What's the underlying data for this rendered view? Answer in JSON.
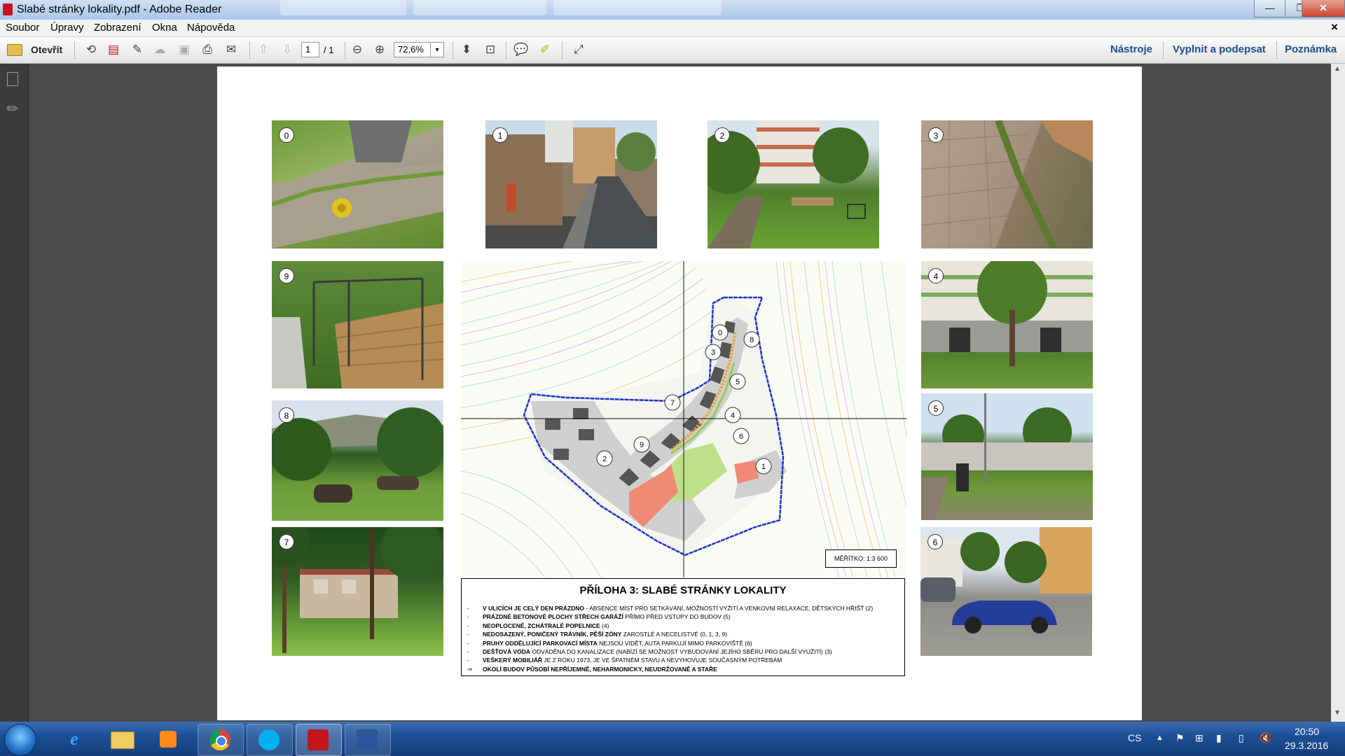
{
  "window": {
    "title": "Slabé stránky lokality.pdf - Adobe Reader",
    "minimize": "—",
    "maximize": "❐",
    "close": "✕"
  },
  "menubar": {
    "items": [
      "Soubor",
      "Úpravy",
      "Zobrazení",
      "Okna",
      "Nápověda"
    ],
    "close_doc": "×"
  },
  "toolbar": {
    "open_label": "Otevřít",
    "page_current": "1",
    "page_total": "/ 1",
    "zoom": "72,6%",
    "tools": "Nástroje",
    "fill_sign": "Vyplnit a podepsat",
    "comment": "Poznámka"
  },
  "document": {
    "photos": [
      {
        "id": "photo-0",
        "number": "0"
      },
      {
        "id": "photo-1",
        "number": "1"
      },
      {
        "id": "photo-2",
        "number": "2"
      },
      {
        "id": "photo-3",
        "number": "3"
      },
      {
        "id": "photo-9",
        "number": "9"
      },
      {
        "id": "photo-4",
        "number": "4"
      },
      {
        "id": "photo-8",
        "number": "8"
      },
      {
        "id": "photo-5",
        "number": "5"
      },
      {
        "id": "photo-7",
        "number": "7"
      },
      {
        "id": "photo-6",
        "number": "6"
      }
    ],
    "map": {
      "scale": "MĚŘÍTKO: 1:3 600",
      "markers": [
        "0",
        "8",
        "3",
        "5",
        "7",
        "4",
        "6",
        "9",
        "2",
        "1"
      ]
    },
    "legend": {
      "heading": "PŘÍLOHA 3: SLABÉ STRÁNKY LOKALITY",
      "items": [
        {
          "bullet": "-",
          "bold": "V ULICÍCH JE CELÝ DEN PRÁZDNO",
          "text": " - ABSENCE MÍST PRO SETKÁVÁNÍ, MOŽNOSTÍ VYŽITÍ A VENKOVNÍ RELAXACE, DĚTSKÝCH HŘIŠŤ (2)"
        },
        {
          "bullet": "-",
          "bold": "PRÁZDNÉ BETONOVÉ PLOCHY STŘECH GARÁŽÍ",
          "text": " PŘÍMO PŘED VSTUPY DO BUDOV (5)"
        },
        {
          "bullet": "-",
          "bold": "NEOPLOCENÉ, ZCHÁTRALÉ POPELNICE",
          "text": " (4)"
        },
        {
          "bullet": "-",
          "bold": "NEDOSAZENÝ, PONIČENÝ TRÁVNÍK, PĚŠÍ ZÓNY",
          "text": " ZAROSTLÉ A NECELISTVÉ (0, 1, 3, 9)"
        },
        {
          "bullet": "-",
          "bold": "PRUHY ODDĚLUJÍCÍ PARKOVACÍ MÍSTA",
          "text": " NEJSOU VIDĚT, AUTA PARKUJÍ MIMO PARKOVIŠTĚ (6)"
        },
        {
          "bullet": "-",
          "bold": "DEŠŤOVÁ VODA",
          "text": " ODVÁDĚNA DO KANALIZACE (NABÍZÍ SE MOŽNOST VYBUDOVÁNÍ JEJÍHO SBĚRU PRO DALŠÍ VYUŽITÍ) (3)"
        },
        {
          "bullet": "-",
          "bold": "VEŠKERÝ MOBILIÁŘ",
          "text": " JE Z ROKU 1973, JE VE ŠPATNÉM STAVU A NEVYHOVUJE SOUČASNÝM POTŘEBÁM"
        },
        {
          "bullet": "⇒",
          "bold": "OKOLÍ BUDOV PŮSOBÍ NEPŘÍJEMNĚ, NEHARMONICKY, NEUDRŽOVANĚ A STAŘE",
          "text": ""
        }
      ]
    }
  },
  "taskbar": {
    "apps": [
      "start",
      "internet-explorer",
      "file-explorer",
      "media-player",
      "chrome",
      "skype",
      "adobe-reader",
      "word"
    ],
    "language": "CS",
    "time": "20:50",
    "date": "29.3.2016"
  },
  "colors": {
    "reader_blue": "#1d4b8f",
    "boundary_blue": "#1a33c9",
    "building_salmon": "#f08a75",
    "lawn_green": "#bfe08a"
  }
}
